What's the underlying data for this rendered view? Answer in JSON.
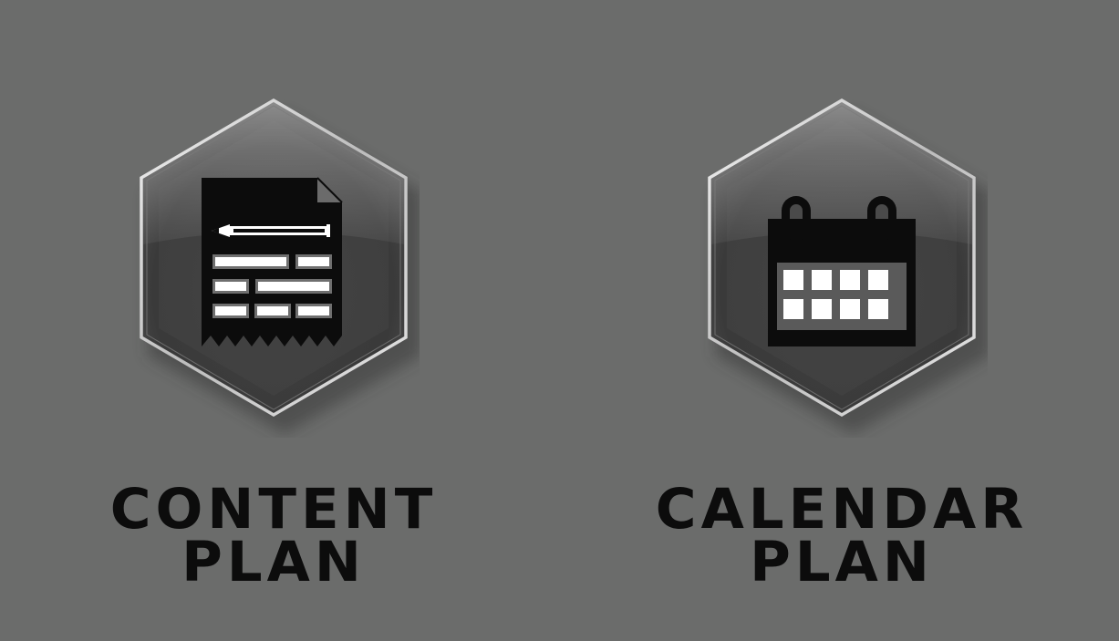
{
  "tiles": [
    {
      "id": "content-plan",
      "icon": "document-pencil-icon",
      "label_line1": "CONTENT",
      "label_line2": "PLAN"
    },
    {
      "id": "calendar-plan",
      "icon": "calendar-icon",
      "label_line1": "CALENDAR",
      "label_line2": "PLAN"
    }
  ],
  "colors": {
    "background": "#6b6c6b",
    "hexagon_dark": "#3a3a3a",
    "hexagon_rim": "#d9d9d9",
    "icon_black": "#0c0c0c",
    "label_text": "#0c0c0c"
  }
}
